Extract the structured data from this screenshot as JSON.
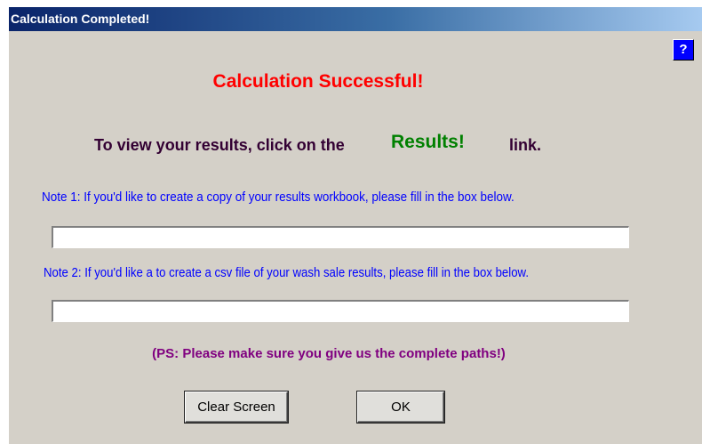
{
  "window": {
    "title": "Calculation Completed!",
    "help_label": "?"
  },
  "main": {
    "heading": "Calculation Successful!",
    "instruction_prefix": "To view your results, click on the",
    "results_link": "Results!",
    "instruction_suffix": "link.",
    "note1": "Note 1: If you'd like to create a copy of your results workbook, please fill in the box below.",
    "copy_path_value": "",
    "note2": "Note 2: If you'd like a to create a csv file of your wash sale results, please fill in the box below.",
    "csv_path_value": "",
    "ps": "(PS:  Please make sure you give us the complete paths!)"
  },
  "buttons": {
    "clear_label": "Clear Screen",
    "ok_label": "OK"
  },
  "colors": {
    "title_bar_start": "#0a246a",
    "title_bar_end": "#a6caf0",
    "dialog_bg": "#d4d0c8",
    "heading": "#ff0000",
    "instruction": "#330033",
    "results_link": "#008000",
    "notes": "#0000ff",
    "ps": "#800080",
    "help_button": "#0000ff"
  }
}
